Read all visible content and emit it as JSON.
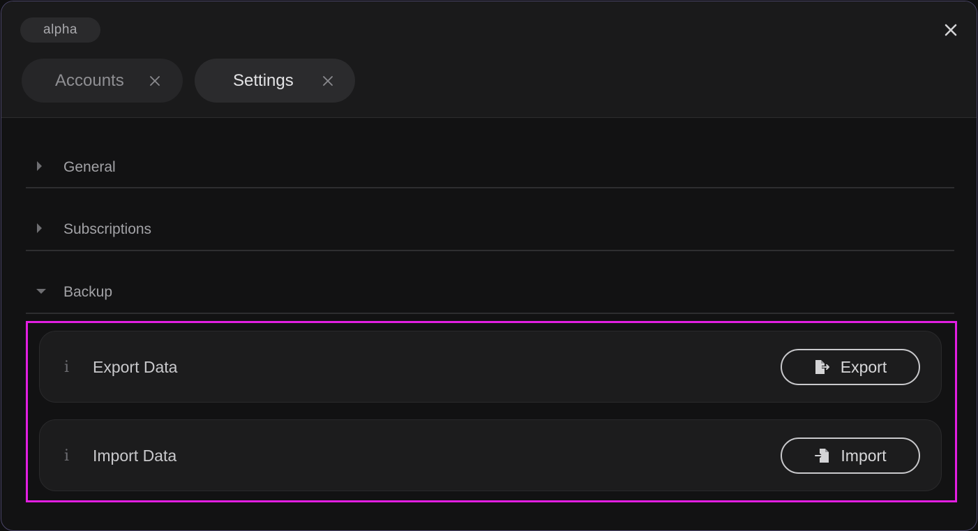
{
  "profile": {
    "name": "alpha"
  },
  "tabs": [
    {
      "label": "Accounts",
      "active": false
    },
    {
      "label": "Settings",
      "active": true
    }
  ],
  "sections": [
    {
      "label": "General",
      "expanded": false
    },
    {
      "label": "Subscriptions",
      "expanded": false
    },
    {
      "label": "Backup",
      "expanded": true
    }
  ],
  "backup": {
    "rows": [
      {
        "label": "Export Data",
        "info_icon": "info-icon",
        "button_label": "Export",
        "button_icon": "file-export-icon"
      },
      {
        "label": "Import Data",
        "info_icon": "info-icon",
        "button_label": "Import",
        "button_icon": "file-import-icon"
      }
    ]
  },
  "icons": {
    "info_glyph": "i"
  },
  "colors": {
    "background": "#121213",
    "highlight": "#e21ee1",
    "window_border": "#4a4568"
  }
}
